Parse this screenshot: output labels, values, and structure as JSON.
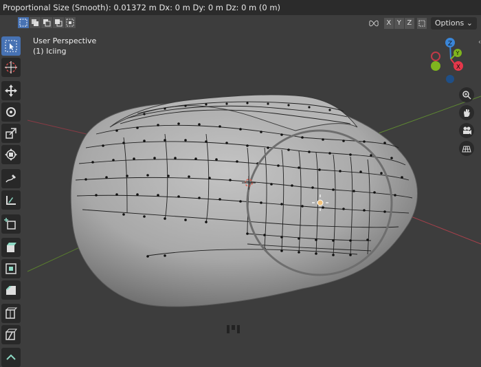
{
  "status": {
    "text": "Proportional Size (Smooth): 0.01372 m   Dx: 0 m   Dy: 0 m   Dz: 0 m (0 m)"
  },
  "header": {
    "select_modes": [
      "select-new",
      "select-extend",
      "select-subtract",
      "select-difference",
      "select-intersect"
    ],
    "mirror_axes": [
      "X",
      "Y",
      "Z"
    ],
    "options_label": "Options"
  },
  "viewport": {
    "perspective": "User Perspective",
    "object": "(1) Iciing",
    "background_color": "#3d3d3d",
    "mesh_color": "#a9a9a9"
  },
  "gizmo": {
    "x_label": "X",
    "y_label": "Y",
    "z_label": "Z",
    "x_color": "#e5374a",
    "y_color": "#7fb51e",
    "z_color": "#3a86d8"
  },
  "toolbar": {
    "tools": [
      "select-box",
      "cursor",
      "move",
      "rotate",
      "scale",
      "transform",
      "annotate",
      "measure",
      "add-cube",
      "extrude-region",
      "inset-faces",
      "bevel",
      "loop-cut",
      "knife",
      "poly-build"
    ]
  },
  "nav_buttons": [
    "zoom",
    "pan",
    "camera",
    "orthographic-grid"
  ]
}
